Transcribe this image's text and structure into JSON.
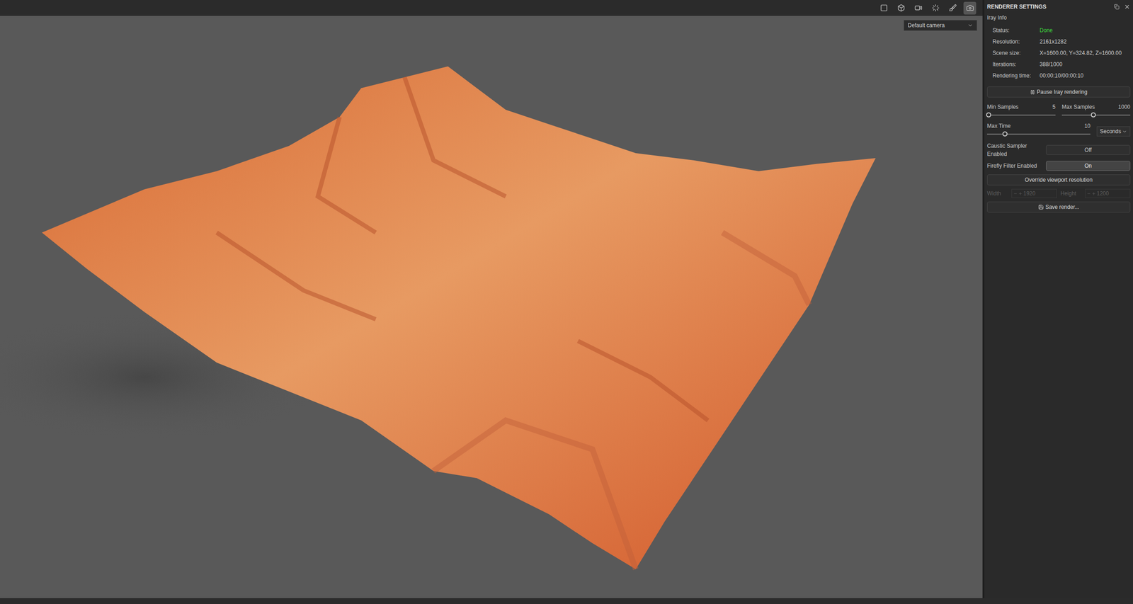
{
  "toolbar": {
    "tools": [
      {
        "selected": false
      },
      {
        "selected": false
      },
      {
        "selected": false
      },
      {
        "selected": false
      },
      {
        "selected": false
      },
      {
        "selected": true
      }
    ],
    "camera": "Default camera"
  },
  "panel": {
    "title": "RENDERER SETTINGS",
    "section": "Iray Info",
    "info": [
      {
        "label": "Status:",
        "value": "Done",
        "color": "#3ddc3d"
      },
      {
        "label": "Resolution:",
        "value": "2161x1282",
        "color": "#d0d0d0"
      },
      {
        "label": "Scene size:",
        "value": "X=1600.00, Y=324.82, Z=1600.00",
        "color": "#d0d0d0"
      },
      {
        "label": "Iterations:",
        "value": "388/1000",
        "color": "#d0d0d0"
      },
      {
        "label": "Rendering time:",
        "value": "00:00:10/00:00:10",
        "color": "#d0d0d0"
      }
    ],
    "pause_button": "Pause Iray rendering",
    "sliders": [
      {
        "label": "Min Samples",
        "reading": "5",
        "level": 0.02
      },
      {
        "label": "Max Samples",
        "reading": "1000",
        "level": 0.46
      },
      {
        "label": "Max Time",
        "reading": "10",
        "level": 0.17
      }
    ],
    "unit_select": "Seconds",
    "toggles": [
      {
        "label": "Caustic Sampler Enabled",
        "value": "Off",
        "on": false
      },
      {
        "label": "Firefly Filter Enabled",
        "value": "On",
        "on": true
      }
    ],
    "override_button": "Override viewport resolution",
    "resolution_fields": [
      {
        "label": "Width",
        "value": "1920",
        "disabled": true
      },
      {
        "label": "Height",
        "value": "1200",
        "disabled": true
      }
    ],
    "save_button": "Save render..."
  }
}
